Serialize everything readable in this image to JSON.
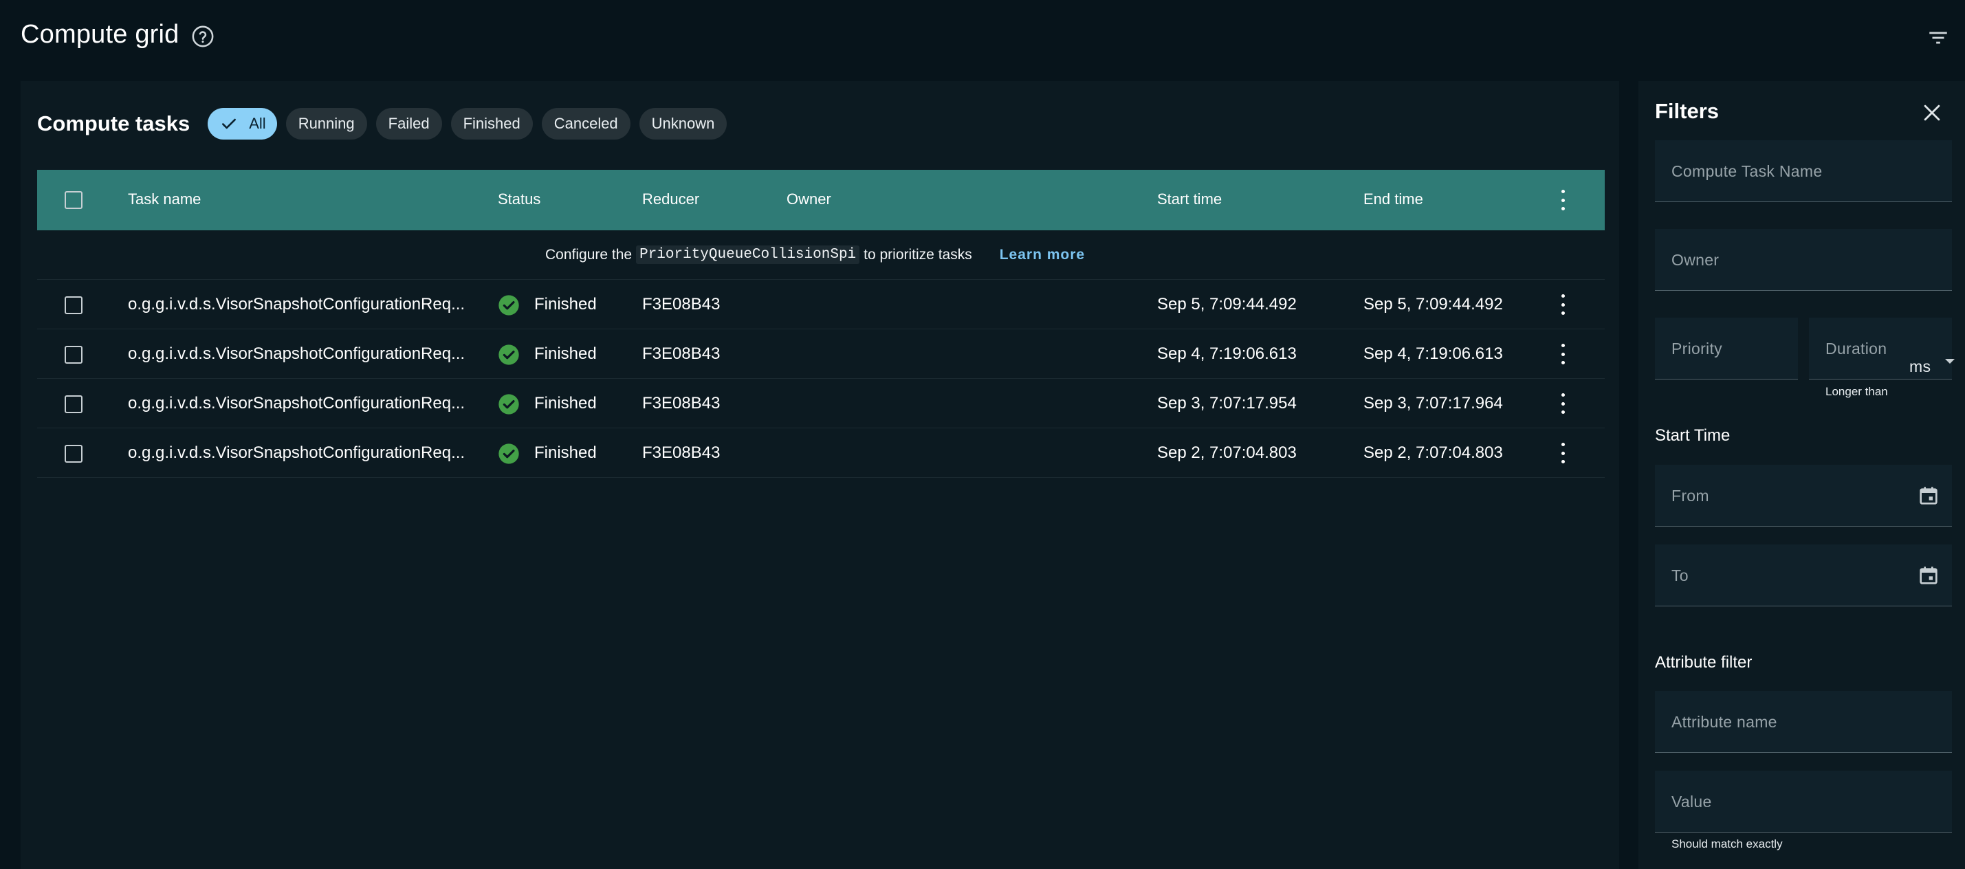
{
  "app": {
    "title": "Compute grid",
    "icons": {
      "help": "help-circle-icon",
      "filter_toggle": "filter-list-icon"
    }
  },
  "tasks": {
    "title": "Compute tasks",
    "chips": [
      {
        "label": "All",
        "selected": true
      },
      {
        "label": "Running",
        "selected": false
      },
      {
        "label": "Failed",
        "selected": false
      },
      {
        "label": "Finished",
        "selected": false
      },
      {
        "label": "Canceled",
        "selected": false
      },
      {
        "label": "Unknown",
        "selected": false
      }
    ]
  },
  "table": {
    "header_color": "#2f7b76",
    "columns": [
      "Task name",
      "Status",
      "Reducer",
      "Owner",
      "Start time",
      "End time"
    ],
    "info": {
      "prefix": "Configure the",
      "code": "PriorityQueueCollisionSpi",
      "suffix": "to prioritize tasks",
      "link": "Learn more"
    },
    "rows": [
      {
        "name": "o.g.g.i.v.d.s.VisorSnapshotConfigurationReq...",
        "status": "Finished",
        "reducer": "F3E08B43",
        "owner": "",
        "start": "Sep 5, 7:09:44.492",
        "end": "Sep 5, 7:09:44.492"
      },
      {
        "name": "o.g.g.i.v.d.s.VisorSnapshotConfigurationReq...",
        "status": "Finished",
        "reducer": "F3E08B43",
        "owner": "",
        "start": "Sep 4, 7:19:06.613",
        "end": "Sep 4, 7:19:06.613"
      },
      {
        "name": "o.g.g.i.v.d.s.VisorSnapshotConfigurationReq...",
        "status": "Finished",
        "reducer": "F3E08B43",
        "owner": "",
        "start": "Sep 3, 7:07:17.954",
        "end": "Sep 3, 7:07:17.964"
      },
      {
        "name": "o.g.g.i.v.d.s.VisorSnapshotConfigurationReq...",
        "status": "Finished",
        "reducer": "F3E08B43",
        "owner": "",
        "start": "Sep 2, 7:07:04.803",
        "end": "Sep 2, 7:07:04.803"
      }
    ],
    "status_color": "#43a047"
  },
  "filters": {
    "title": "Filters",
    "task_name_placeholder": "Compute Task Name",
    "owner_placeholder": "Owner",
    "priority_placeholder": "Priority",
    "duration_placeholder": "Duration",
    "duration_unit": "ms",
    "duration_helper": "Longer than",
    "start_time_label": "Start Time",
    "from_placeholder": "From",
    "to_placeholder": "To",
    "attribute_label": "Attribute filter",
    "attribute_name_placeholder": "Attribute name",
    "value_placeholder": "Value",
    "value_helper": "Should match exactly"
  }
}
